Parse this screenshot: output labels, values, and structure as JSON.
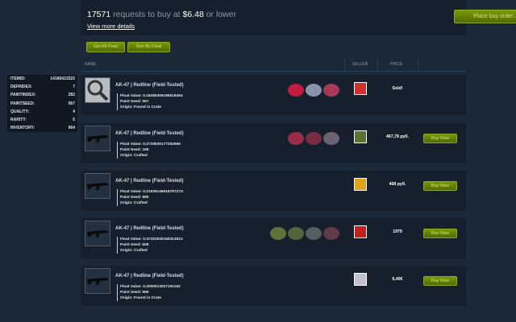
{
  "header": {
    "request_count": "17571",
    "request_text": "requests to buy at",
    "price": "$6.48",
    "price_suffix": "or lower",
    "view_more": "View more details",
    "place_order": "Place buy order..."
  },
  "toolbar": {
    "get_all_float": "Get All Float",
    "sort_by_float": "Sort By Float"
  },
  "columns": {
    "name": "NAME",
    "seller": "SELLER",
    "price": "PRICE"
  },
  "sidebar": [
    {
      "label": "ITEMID:",
      "value": "14180421522"
    },
    {
      "label": "DEFINDEX:",
      "value": "7"
    },
    {
      "label": "PAINTINDEX:",
      "value": "282"
    },
    {
      "label": "PAINTSEED:",
      "value": "567"
    },
    {
      "label": "QUALITY:",
      "value": "4"
    },
    {
      "label": "RARITY:",
      "value": "5"
    },
    {
      "label": "INVENTORY:",
      "value": "964"
    }
  ],
  "buy_label": "Buy Now",
  "listings": [
    {
      "name": "AK-47 | Redline (Field-Tested)",
      "float": "Float Value: 0.16285309195518494",
      "seed": "Paint Seed: 567",
      "origin": "Origin: Found in Crate",
      "price": "Sold!",
      "buy": false,
      "thumb": "magnifier-icon",
      "stickers": [
        "#e01c48",
        "#a0a8c0",
        "#c04060"
      ]
    },
    {
      "name": "AK-47 | Redline (Field-Tested)",
      "float": "Float Value: 0.2729630177252665",
      "seed": "Paint Seed: 169",
      "origin": "Origin: Crafted",
      "price": "467,78 руб.",
      "buy": true,
      "thumb": "rifle-icon",
      "stickers": [
        "#b03050",
        "#8a3048",
        "#7a7080"
      ]
    },
    {
      "name": "AK-47 | Redline (Field-Tested)",
      "float": "Float Value: 0.2193914651870727S",
      "seed": "Paint Seed: 995",
      "origin": "Origin: Crafted",
      "price": "468 руб.",
      "buy": true,
      "thumb": "rifle-icon",
      "stickers": []
    },
    {
      "name": "AK-47 | Redline (Field-Tested)",
      "float": "Float Value: 0.37322530150413513",
      "seed": "Paint Seed: 508",
      "origin": "Origin: Crafted",
      "price": "1979",
      "buy": true,
      "thumb": "rifle-icon",
      "stickers": [
        "#708040",
        "#607040",
        "#606870",
        "#704050"
      ]
    },
    {
      "name": "AK-47 | Redline (Field-Tested)",
      "float": "Float Value: 0.2000013027191162",
      "seed": "Paint Seed: 959",
      "origin": "Origin: Found in Crate",
      "price": "6,40€",
      "buy": true,
      "thumb": "rifle-icon",
      "stickers": []
    }
  ]
}
